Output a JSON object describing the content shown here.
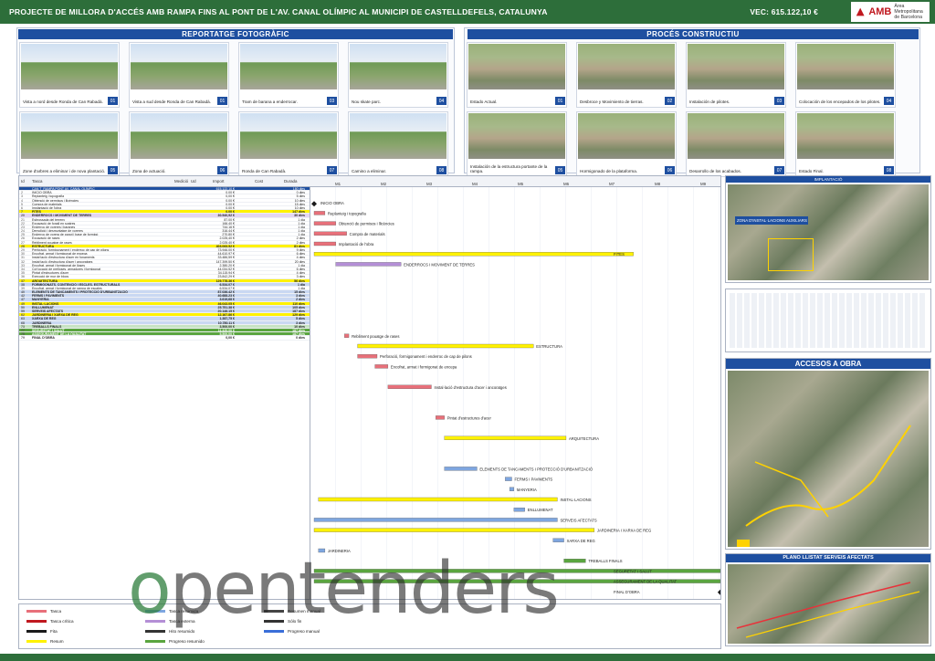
{
  "header": {
    "title": "PROJECTE DE MILLORA D'ACCÉS AMB RAMPA FINS AL PONT DE L'AV. CANAL OLÍMPIC AL MUNICIPI DE CASTELLDEFELS, CATALUNYA",
    "budget": "VEC: 615.122,10 €",
    "logo": "AMB",
    "logo_sub1": "Àrea Metropolitana",
    "logo_sub2": "de Barcelona"
  },
  "sections": {
    "photo_report": "REPORTATGE FOTOGRÀFIC",
    "process": "PROCÉS CONSTRUCTIU",
    "implantation": "IMPLANTACIÓ",
    "access": "ACCESOS A OBRA",
    "services": "PLANO LLISTAT SERVEIS AFECTATS",
    "zone": "ZONA D'INSTAL·LACIONS AUXILIARS"
  },
  "photos": [
    {
      "caption": "Vista a nord desde Ronda de Can Rabadà.",
      "num": "01"
    },
    {
      "caption": "Vista a sud desde Ronda de Can Rabadà.",
      "num": "01"
    },
    {
      "caption": "Tram de barana a enderrocar.",
      "num": "03"
    },
    {
      "caption": "Nou skate parc.",
      "num": "04"
    },
    {
      "caption": "Zone d'arbres a eliminar i de nova plantació.",
      "num": "05"
    },
    {
      "caption": "Zona de actuació.",
      "num": "06"
    },
    {
      "caption": "Ronda de Can Rabadà.",
      "num": "07"
    },
    {
      "caption": "Camino a eliminar.",
      "num": "08"
    }
  ],
  "process": [
    {
      "caption": "Estado Actual.",
      "num": "01"
    },
    {
      "caption": "Desbroce y Movimiento de tierras.",
      "num": "02"
    },
    {
      "caption": "Instalación de pilotes.",
      "num": "03"
    },
    {
      "caption": "Colocación de los encepados de los pilotes.",
      "num": "04"
    },
    {
      "caption": "Instalación de la estructura portante de la rampa.",
      "num": "05"
    },
    {
      "caption": "Hormigonado de la plataforma.",
      "num": "06"
    },
    {
      "caption": "Desarrollo de los acabados.",
      "num": "07"
    },
    {
      "caption": "Estado Final.",
      "num": "08"
    }
  ],
  "gantt": {
    "headers": [
      "Id",
      "Tasca",
      "Medició",
      "Ud",
      "Import",
      "Cost",
      "Durada"
    ],
    "months": [
      "M1",
      "M2",
      "M3",
      "M4",
      "M5",
      "M6",
      "M7",
      "M8",
      "M9"
    ],
    "rows": [
      {
        "n": "1",
        "name": "CAN T_RAMPA PONT AV. CANAL OLÍMPIC",
        "import": "615.122,10 €",
        "dur": "180 dies",
        "cls": "bl"
      },
      {
        "n": "2",
        "name": "INICIO OBRA",
        "import": "0,00 €",
        "dur": "0 dies",
        "cls": ""
      },
      {
        "n": "3",
        "name": "Replanteig i topografia",
        "import": "0,00 €",
        "dur": "5 dies",
        "cls": ""
      },
      {
        "n": "4",
        "name": "Obtenció de permisos i llicències",
        "import": "0,00 €",
        "dur": "10 dies",
        "cls": ""
      },
      {
        "n": "5",
        "name": "Compra de materials",
        "import": "0,00 €",
        "dur": "15 dies",
        "cls": ""
      },
      {
        "n": "6",
        "name": "Implantació de l'obra",
        "import": "0,00 €",
        "dur": "10 dies",
        "cls": ""
      },
      {
        "n": "7",
        "name": "FITES",
        "import": "0,00 €",
        "dur": "147 dies",
        "cls": "y sum"
      },
      {
        "n": "20",
        "name": "ENDERROCS I MOVIMENT DE TERRES",
        "import": "30.540,92 €",
        "dur": "30 dies",
        "cls": "p sum"
      },
      {
        "n": "21",
        "name": "Esbrossada del terreny",
        "import": "87,00 €",
        "dur": "1 dia",
        "cls": ""
      },
      {
        "n": "22",
        "name": "Excavació de fonall en sostres",
        "import": "166,40 €",
        "dur": "1 dia",
        "cls": ""
      },
      {
        "n": "23",
        "name": "Enderroc de voreres i baranes",
        "import": "744,16 €",
        "dur": "1 dia",
        "cls": ""
      },
      {
        "n": "24",
        "name": "Demolició i desmuntatge de voreres",
        "import": "316,44 €",
        "dur": "1 dia",
        "cls": ""
      },
      {
        "n": "25",
        "name": "Enderroc de vorera de panot i base de formigó",
        "import": "270,80 €",
        "dur": "1 dia",
        "cls": ""
      },
      {
        "n": "26",
        "name": "Excavació de rases",
        "import": "2.025,40 €",
        "dur": "2 dies",
        "cls": ""
      },
      {
        "n": "27",
        "name": "Rebliment pouatge de rases",
        "import": "2.025,40 €",
        "dur": "2 dies",
        "cls": ""
      },
      {
        "n": "28",
        "name": "ESTRUCTURA",
        "import": "403.063,52 €",
        "dur": "81 dies",
        "cls": "y sum"
      },
      {
        "n": "29",
        "name": "Perforació, formigonament i enderroc de cap de pilons",
        "import": "73.946,00 €",
        "dur": "9 dies",
        "cls": ""
      },
      {
        "n": "30",
        "name": "Encofrat, armat i formigonat de encepa",
        "import": "44.610,97 €",
        "dur": "6 dies",
        "cls": ""
      },
      {
        "n": "31",
        "name": "Instal·lació d'estructura d'acer en fonaments",
        "import": "33.486,59 €",
        "dur": "4 dies",
        "cls": ""
      },
      {
        "n": "32",
        "name": "Instal·lació d'estructura d'acer i ancoratges",
        "import": "147.399,50 €",
        "dur": "20 dies",
        "cls": ""
      },
      {
        "n": "33",
        "name": "Encofrat, armat i formigonat de lloses",
        "import": "2.380,20 €",
        "dur": "1 dia",
        "cls": ""
      },
      {
        "n": "34",
        "name": "Col·locació de prelloses, armadures i formigonat",
        "import": "44.034,52 €",
        "dur": "6 dies",
        "cls": ""
      },
      {
        "n": "35",
        "name": "Pintat d'estructures d'acer",
        "import": "34.115,94 €",
        "dur": "4 dies",
        "cls": ""
      },
      {
        "n": "36",
        "name": "Execució de mur de blocs",
        "import": "23.842,29 €",
        "dur": "3 dies",
        "cls": ""
      },
      {
        "n": "37",
        "name": "ARQUITECTURA",
        "import": "129.778,36 €",
        "dur": "56 dies",
        "cls": "y sum"
      },
      {
        "n": "38",
        "name": "FORMIGONATS, CONTENCIÓ I ESCLES. ESTRUCTURALS",
        "import": "6.534,07 €",
        "dur": "1 dia",
        "cls": "b sum"
      },
      {
        "n": "39",
        "name": "Encofrat, armat i formigonat de rampa de escales",
        "import": "6.534,07 €",
        "dur": "1 dia",
        "cls": ""
      },
      {
        "n": "40",
        "name": "ELEMENTS DE TANCAMENTS I PROTECCIÓ D'URBANITZACIÓ",
        "import": "87.036,42 €",
        "dur": "15 dies",
        "cls": "b sum"
      },
      {
        "n": "42",
        "name": "FERMS I PAVIMENTS",
        "import": "40.688,23 €",
        "dur": "3 dies",
        "cls": "b sum"
      },
      {
        "n": "47",
        "name": "MANYERIA",
        "import": "3.619,68 €",
        "dur": "2 dies",
        "cls": "b sum"
      },
      {
        "n": "49",
        "name": "INSTAL·LACIONS",
        "import": "46.043,05 €",
        "dur": "110 dies",
        "cls": "y sum"
      },
      {
        "n": "50",
        "name": "ENLLUMENAT",
        "import": "25.751,38 €",
        "dur": "105 dies",
        "cls": "b sum"
      },
      {
        "n": "59",
        "name": "SERVEIS AFECTATS",
        "import": "20.146,15 €",
        "dur": "187 dies",
        "cls": "b sum"
      },
      {
        "n": "62",
        "name": "JARDINERIA I XARXA DE REG",
        "import": "12.167,86 €",
        "dur": "129 dies",
        "cls": "y sum"
      },
      {
        "n": "63",
        "name": "XARXA DE REG",
        "import": "1.387,75 €",
        "dur": "5 dies",
        "cls": "b sum"
      },
      {
        "n": "68",
        "name": "JARDINERIA",
        "import": "10.780,11 €",
        "dur": "3 dies",
        "cls": "b sum"
      },
      {
        "n": "73",
        "name": "TREBALLS FINALS",
        "import": "3.500,00 €",
        "dur": "10 dies",
        "cls": "g sum"
      },
      {
        "n": "77",
        "name": "SEGURETAT I SALUT",
        "import": "11.420,00 €",
        "dur": "187 dies",
        "cls": "gg sum"
      },
      {
        "n": "78",
        "name": "ASSEGURAMENT DE LA QUALITAT",
        "import": "5.500,00 €",
        "dur": "187 dies",
        "cls": "gg sum"
      },
      {
        "n": "79",
        "name": "FINAL D'OBRA",
        "import": "0,00 €",
        "dur": "0 dies",
        "cls": "sum"
      }
    ],
    "bars": [
      {
        "label": "INICIO OBRA",
        "row": 1,
        "start": 0,
        "len": 0,
        "color": "#1a1a1a"
      },
      {
        "label": "Replanteig i topografia",
        "row": 2,
        "start": 0,
        "len": 5,
        "color": "#e8707a"
      },
      {
        "label": "Obtenció de permisos i llicències",
        "row": 3,
        "start": 0,
        "len": 10,
        "color": "#e8707a"
      },
      {
        "label": "Compra de materials",
        "row": 4,
        "start": 0,
        "len": 15,
        "color": "#e8707a"
      },
      {
        "label": "Implantació de l'obra",
        "row": 5,
        "start": 0,
        "len": 10,
        "color": "#e8707a"
      },
      {
        "label": "FITES",
        "row": 6,
        "start": 0,
        "len": 147,
        "color": "#fff200"
      },
      {
        "label": "ENDERROCS I MOVIMENT DE TERRES",
        "row": 7,
        "start": 10,
        "len": 30,
        "color": "#b48fd6"
      },
      {
        "label": "Rebliment pouatge de rases",
        "row": 14,
        "start": 14,
        "len": 2,
        "color": "#e8707a"
      },
      {
        "label": "ESTRUCTURA",
        "row": 15,
        "start": 20,
        "len": 81,
        "color": "#fff200"
      },
      {
        "label": "Perforació, formigonament i enderroc de cap de pilons",
        "row": 16,
        "start": 20,
        "len": 9,
        "color": "#e8707a"
      },
      {
        "label": "Encofrat, armat i formigonat de encepa",
        "row": 17,
        "start": 28,
        "len": 6,
        "color": "#e8707a"
      },
      {
        "label": "Instal·lació d'estructura d'acer i ancoratges",
        "row": 19,
        "start": 34,
        "len": 20,
        "color": "#e8707a"
      },
      {
        "label": "Pintat d'estructures d'acer",
        "row": 22,
        "start": 56,
        "len": 4,
        "color": "#e8707a"
      },
      {
        "label": "ARQUITECTURA",
        "row": 24,
        "start": 60,
        "len": 56,
        "color": "#fff200"
      },
      {
        "label": "ELEMENTS DE TANCAMENTS I PROTECCIÓ D'URBANITZACIÓ",
        "row": 27,
        "start": 60,
        "len": 15,
        "color": "#7ea6e0"
      },
      {
        "label": "FERMS I PAVIMENTS",
        "row": 28,
        "start": 88,
        "len": 3,
        "color": "#7ea6e0"
      },
      {
        "label": "MANYERIA",
        "row": 29,
        "start": 90,
        "len": 2,
        "color": "#7ea6e0"
      },
      {
        "label": "INSTAL·LACIONS",
        "row": 30,
        "start": 2,
        "len": 110,
        "color": "#fff200"
      },
      {
        "label": "ENLLUMENAT",
        "row": 31,
        "start": 92,
        "len": 5,
        "color": "#7ea6e0"
      },
      {
        "label": "SERVEIS AFECTATS",
        "row": 32,
        "start": 0,
        "len": 112,
        "color": "#7ea6e0"
      },
      {
        "label": "JARDINERIA I XARXA DE REG",
        "row": 33,
        "start": 0,
        "len": 129,
        "color": "#fff200"
      },
      {
        "label": "XARXA DE REG",
        "row": 34,
        "start": 110,
        "len": 5,
        "color": "#7ea6e0"
      },
      {
        "label": "JARDINERIA",
        "row": 35,
        "start": 2,
        "len": 3,
        "color": "#7ea6e0"
      },
      {
        "label": "TREBALLS FINALS",
        "row": 36,
        "start": 115,
        "len": 10,
        "color": "#5aa53f"
      },
      {
        "label": "SEGURETAT I SALUT",
        "row": 37,
        "start": 0,
        "len": 187,
        "color": "#5aa53f"
      },
      {
        "label": "ASSEGURAMENT DE LA QUALITAT",
        "row": 38,
        "start": 0,
        "len": 187,
        "color": "#5aa53f"
      },
      {
        "label": "FINAL D'OBRA",
        "row": 39,
        "start": 187,
        "len": 0,
        "color": "#1a1a1a"
      }
    ],
    "total_days": 190
  },
  "legend": [
    {
      "label": "Tasca",
      "color": "#e8707a"
    },
    {
      "label": "Tasca crítica",
      "color": "#c0181f"
    },
    {
      "label": "Fita",
      "color": "#1a1a1a"
    },
    {
      "label": "Resum",
      "color": "#fff200"
    },
    {
      "label": "Tasca resumida",
      "color": "#7ea6e0"
    },
    {
      "label": "Tasca externa",
      "color": "#b48fd6"
    },
    {
      "label": "Hito resumido",
      "color": "#333333"
    },
    {
      "label": "Progreso resumido",
      "color": "#5aa53f"
    },
    {
      "label": "Resumen manual",
      "color": "#444444"
    },
    {
      "label": "Sólo fin",
      "color": "#333333"
    },
    {
      "label": "Progreso manual",
      "color": "#3a6ed8"
    }
  ],
  "watermark": "opentenders",
  "colors": {
    "header_green": "#2d6e3a",
    "section_blue": "#1e4fa0",
    "brand_red": "#c0181f"
  }
}
